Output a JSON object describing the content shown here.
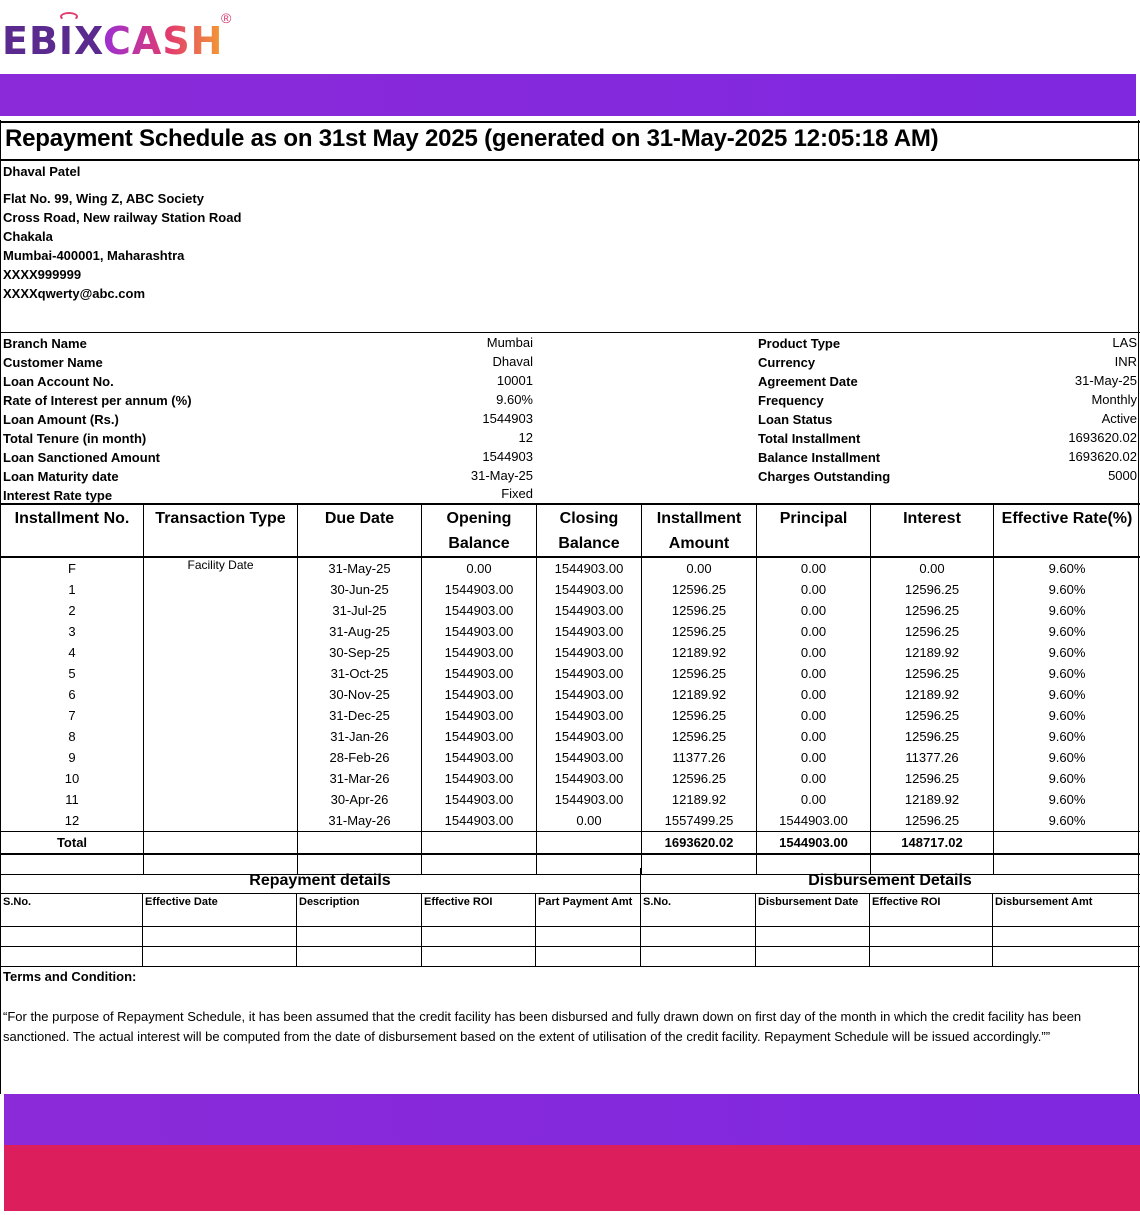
{
  "logo": {
    "ebix": "EBIX",
    "cash": "CASH",
    "reg": "®"
  },
  "title": "Repayment Schedule as on 31st May 2025 (generated on 31-May-2025 12:05:18 AM)",
  "customer": {
    "name": "Dhaval Patel",
    "address": [
      "Flat No. 99, Wing Z, ABC Society",
      "Cross Road, New railway Station Road",
      "Chakala",
      "Mumbai-400001, Maharashtra",
      "XXXX999999",
      "XXXXqwerty@abc.com"
    ]
  },
  "left_details": [
    {
      "label": "Branch Name",
      "value": "Mumbai"
    },
    {
      "label": "Customer Name",
      "value": "Dhaval"
    },
    {
      "label": "Loan Account No.",
      "value": "10001"
    },
    {
      "label": "Rate of Interest per annum (%)",
      "value": "9.60%"
    },
    {
      "label": "Loan Amount (Rs.)",
      "value": "1544903"
    },
    {
      "label": "Total Tenure (in month)",
      "value": "12"
    },
    {
      "label": "Loan Sanctioned Amount",
      "value": "1544903"
    },
    {
      "label": "Loan Maturity date",
      "value": "31-May-25"
    },
    {
      "label": "Interest Rate type",
      "value": "Fixed"
    }
  ],
  "right_details": [
    {
      "label": "Product Type",
      "value": "LAS"
    },
    {
      "label": "Currency",
      "value": "INR"
    },
    {
      "label": "Agreement Date",
      "value": "31-May-25"
    },
    {
      "label": "Frequency",
      "value": "Monthly"
    },
    {
      "label": "Loan Status",
      "value": "Active"
    },
    {
      "label": "Total Installment",
      "value": "1693620.02"
    },
    {
      "label": "Balance Installment",
      "value": "1693620.02"
    },
    {
      "label": "Charges Outstanding",
      "value": "5000"
    }
  ],
  "schedule": {
    "headers": [
      "Installment No.",
      "Transaction Type",
      "Due Date",
      "Opening Balance",
      "Closing Balance",
      "Installment Amount",
      "Principal",
      "Interest",
      "Effective Rate(%)"
    ],
    "rows": [
      [
        "F",
        "Facility Date",
        "31-May-25",
        "0.00",
        "1544903.00",
        "0.00",
        "0.00",
        "0.00",
        "9.60%"
      ],
      [
        "1",
        "",
        "30-Jun-25",
        "1544903.00",
        "1544903.00",
        "12596.25",
        "0.00",
        "12596.25",
        "9.60%"
      ],
      [
        "2",
        "",
        "31-Jul-25",
        "1544903.00",
        "1544903.00",
        "12596.25",
        "0.00",
        "12596.25",
        "9.60%"
      ],
      [
        "3",
        "",
        "31-Aug-25",
        "1544903.00",
        "1544903.00",
        "12596.25",
        "0.00",
        "12596.25",
        "9.60%"
      ],
      [
        "4",
        "",
        "30-Sep-25",
        "1544903.00",
        "1544903.00",
        "12189.92",
        "0.00",
        "12189.92",
        "9.60%"
      ],
      [
        "5",
        "",
        "31-Oct-25",
        "1544903.00",
        "1544903.00",
        "12596.25",
        "0.00",
        "12596.25",
        "9.60%"
      ],
      [
        "6",
        "",
        "30-Nov-25",
        "1544903.00",
        "1544903.00",
        "12189.92",
        "0.00",
        "12189.92",
        "9.60%"
      ],
      [
        "7",
        "",
        "31-Dec-25",
        "1544903.00",
        "1544903.00",
        "12596.25",
        "0.00",
        "12596.25",
        "9.60%"
      ],
      [
        "8",
        "",
        "31-Jan-26",
        "1544903.00",
        "1544903.00",
        "12596.25",
        "0.00",
        "12596.25",
        "9.60%"
      ],
      [
        "9",
        "",
        "28-Feb-26",
        "1544903.00",
        "1544903.00",
        "11377.26",
        "0.00",
        "11377.26",
        "9.60%"
      ],
      [
        "10",
        "",
        "31-Mar-26",
        "1544903.00",
        "1544903.00",
        "12596.25",
        "0.00",
        "12596.25",
        "9.60%"
      ],
      [
        "11",
        "",
        "30-Apr-26",
        "1544903.00",
        "1544903.00",
        "12189.92",
        "0.00",
        "12189.92",
        "9.60%"
      ],
      [
        "12",
        "",
        "31-May-26",
        "1544903.00",
        "0.00",
        "1557499.25",
        "1544903.00",
        "12596.25",
        "9.60%"
      ]
    ],
    "total": [
      "Total",
      "",
      "",
      "",
      "",
      "1693620.02",
      "1544903.00",
      "148717.02",
      ""
    ]
  },
  "repayment_details": {
    "title": "Repayment details",
    "headers": [
      "S.No.",
      "Effective Date",
      "Description",
      "Effective ROI",
      "Part Payment Amt"
    ]
  },
  "disbursement_details": {
    "title": "Disbursement Details",
    "headers": [
      "S.No.",
      "Disbursement Date",
      "Effective ROI",
      "Disbursement Amt"
    ]
  },
  "terms": {
    "heading": "Terms and Condition:",
    "text": "“For the purpose of Repayment Schedule, it has been assumed that the credit facility has been disbursed and fully drawn down on first day of the month in which the credit facility has been sanctioned. The actual interest will be computed from the date of disbursement based on the extent of utilisation of the credit facility. Repayment Schedule will be issued accordingly.””"
  },
  "colors": {
    "purple_band": "#8b2ad8",
    "pink_band": "#dc1f5c"
  }
}
